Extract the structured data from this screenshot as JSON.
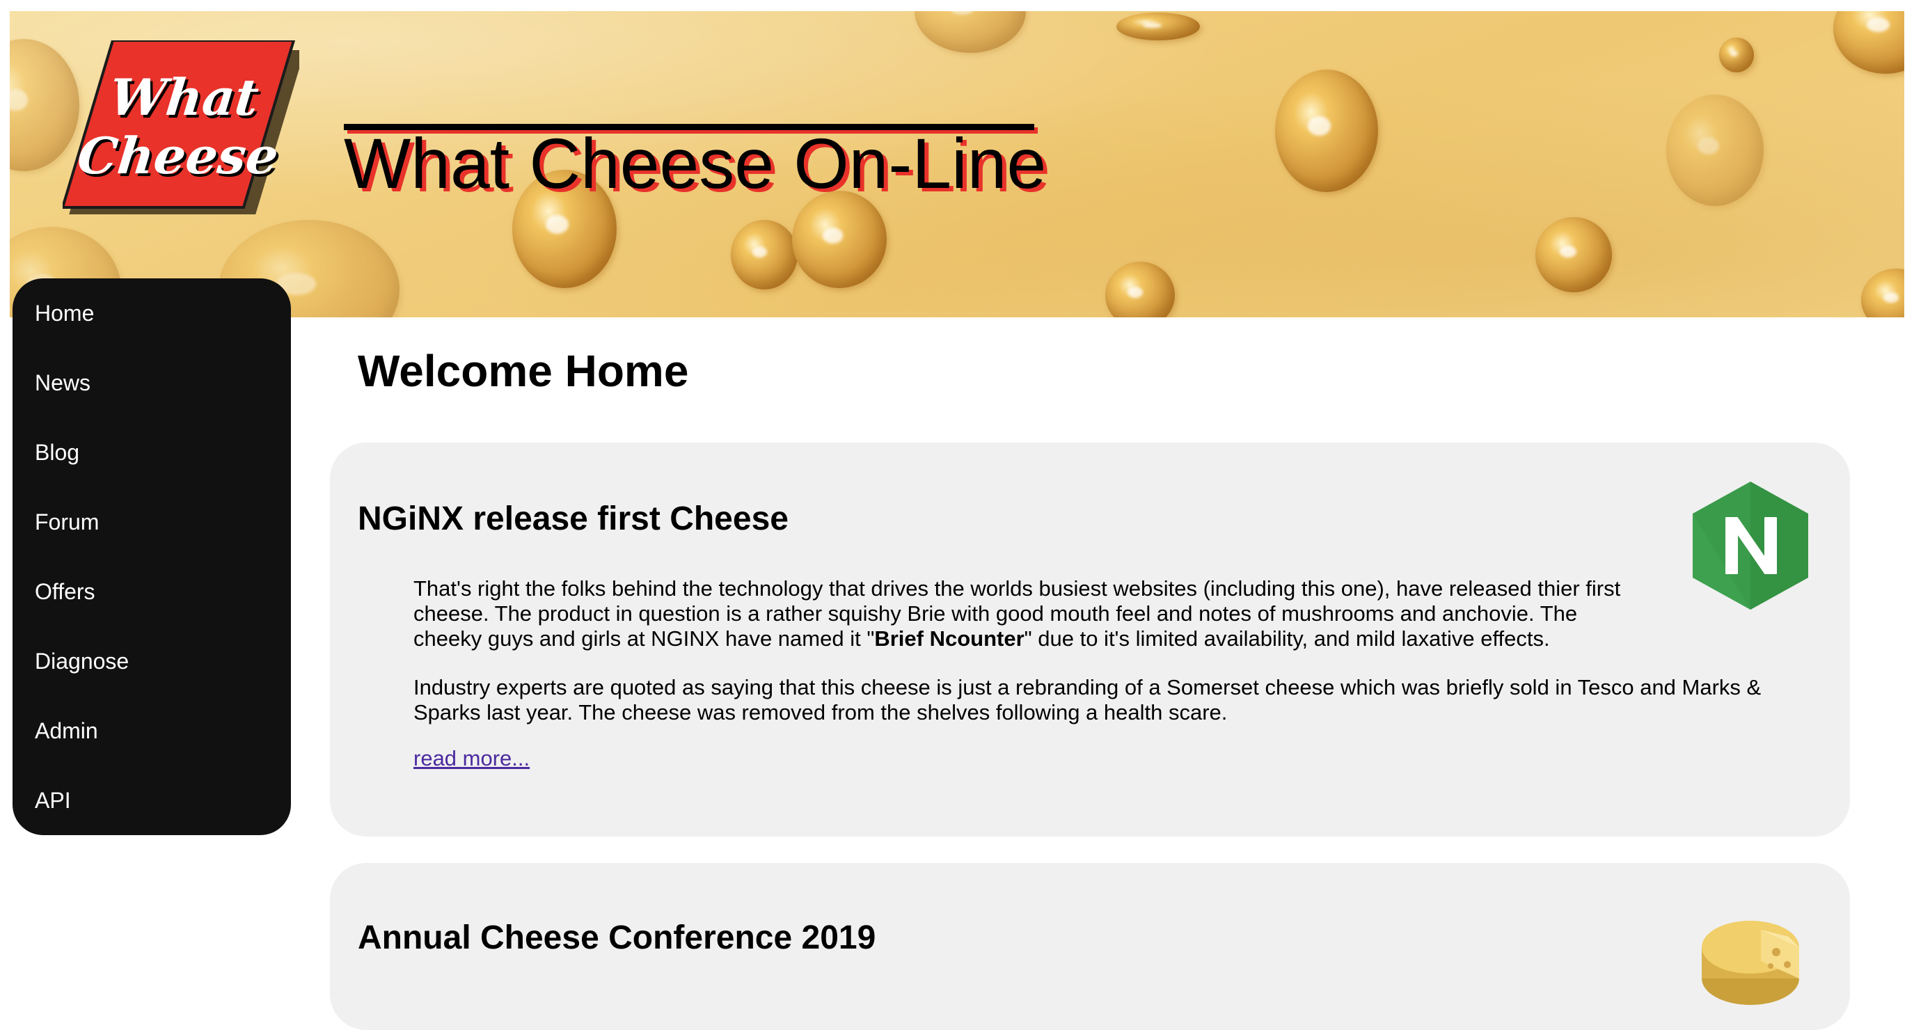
{
  "header": {
    "logo": {
      "line1": "What",
      "line2": "Cheese"
    },
    "site_title": "What Cheese On-Line"
  },
  "sidebar": {
    "items": [
      {
        "label": "Home"
      },
      {
        "label": "News"
      },
      {
        "label": "Blog"
      },
      {
        "label": "Forum"
      },
      {
        "label": "Offers"
      },
      {
        "label": "Diagnose"
      },
      {
        "label": "Admin"
      },
      {
        "label": "API"
      }
    ]
  },
  "main": {
    "page_title": "Welcome Home",
    "articles": [
      {
        "title": "NGiNX release first Cheese",
        "icon": "nginx-logo-icon",
        "para1_a": "That's right the folks behind the technology that drives the worlds busiest websites (including this one), have released thier first cheese. The product in question is a rather squishy Brie with good mouth feel and notes of mushrooms and anchovie. The cheeky guys and girls at NGINX have named it \"",
        "para1_bold": "Brief Ncounter",
        "para1_b": "\" due to it's limited availability, and mild laxative effects.",
        "para2": "Industry experts are quoted as saying that this cheese is just a rebranding of a Somerset cheese which was briefly sold in Tesco and Marks & Sparks last year. The cheese was removed from the shelves following a health scare.",
        "read_more": "read more..."
      },
      {
        "title": "Annual Cheese Conference 2019",
        "icon": "cheese-wheel-icon"
      }
    ]
  },
  "colors": {
    "sidebar_bg": "#111111",
    "card_bg": "#f0f0f0",
    "logo_red": "#e8322a",
    "link": "#4b2aa0",
    "nginx_green": "#3a9b4a"
  }
}
